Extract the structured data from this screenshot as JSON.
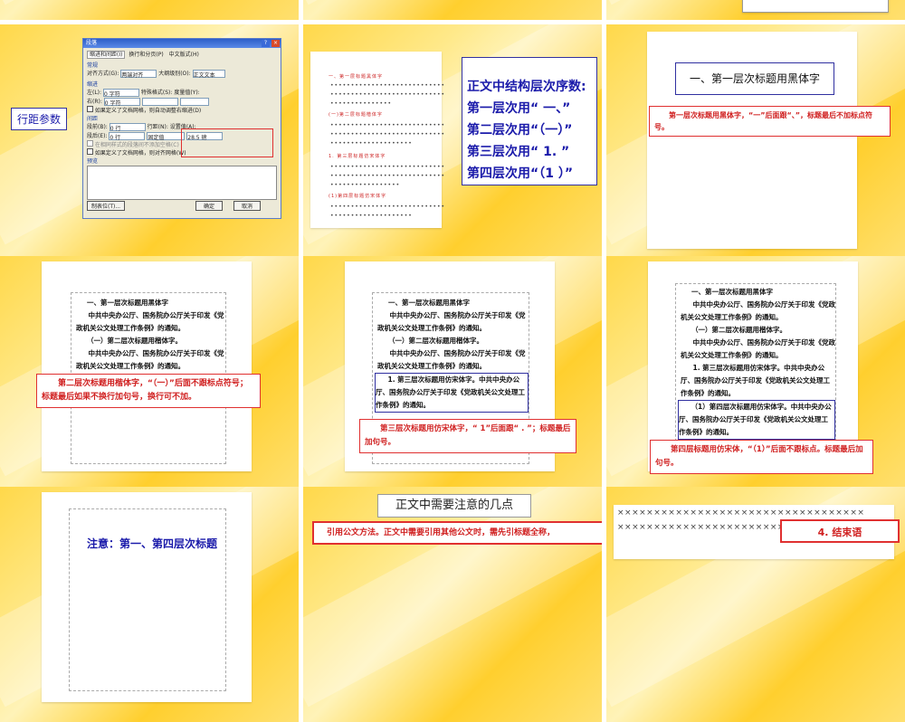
{
  "colors": {
    "accent_red": "#d02020",
    "accent_blue": "#1a1aaa"
  },
  "slide2": {
    "label": "行距参数",
    "dialog": {
      "title": "段落",
      "tabs": [
        "缩进和间距(I)",
        "换行和分页(P)",
        "中文版式(H)"
      ],
      "section_general": "常规",
      "align_label": "对齐方式(G):",
      "align_value": "两端对齐",
      "outline_label": "大纲级别(O):",
      "outline_value": "正文文本",
      "section_indent": "缩进",
      "left_label": "左(L):",
      "left_value": "0 字符",
      "right_label": "右(R):",
      "right_value": "0 字符",
      "special_label": "特殊格式(S):",
      "by_label": "度量值(Y):",
      "auto_indent": "如果定义了文档网格，则自动调整右缩进(D)",
      "section_spacing": "间距",
      "before_label": "段前(B):",
      "before_value": "0 行",
      "after_label": "段后(E):",
      "after_value": "0 行",
      "line_label": "行距(N):",
      "line_value": "固定值",
      "at_label": "设置值(A):",
      "at_value": "28.5 磅",
      "no_space": "在相同样式的段落间不添加空格(C)",
      "snap_grid": "如果定义了文档网格，则对齐网格(W)",
      "section_preview": "预览",
      "tabs_button": "制表位(T)...",
      "ok_button": "确定",
      "cancel_button": "取消"
    }
  },
  "slide3": {
    "lines": [
      "一、第一层标题黑体字",
      "(一)第二层标题楷体字",
      "1. 第三层标题仿宋体字",
      "(1)第四层标题仿宋体字"
    ],
    "box_title": "正文中结构层次序数:",
    "box_items": [
      "第一层次用“ 一、”",
      "第二层次用“（一）”",
      "第三层次用“ 1. ”",
      "第四层次用“（1 ）”"
    ]
  },
  "slide4": {
    "heading": "一、第一层次标题用黑体字",
    "note": "第一层次标题用黑体字，“一”后面跟“、”，标题最后不加标点符号。"
  },
  "body": {
    "h1": "一、第一层次标题用黑体字",
    "p1": "中共中央办公厅、国务院办公厅关于印发《党政机关公文处理工作条例》的通知。",
    "h2": "（一）第二层次标题用楷体字。",
    "p2": "中共中央办公厅、国务院办公厅关于印发《党政机关公文处理工作条例》的通知。",
    "h3": "1. 第三层次标题用仿宋体字。中共中央办公厅、国务院办公厅关于印发《党政机关公文处理工作条例》的通知。",
    "h4": "（1）第四层次标题用仿宋体字。中共中央办公厅、国务院办公厅关于印发《党政机关公文处理工作条例》的通知。"
  },
  "slide5": {
    "note": "第二层次标题用楷体字，“（一）”后面不跟标点符号；标题最后如果不换行加句号，换行可不加。"
  },
  "slide6": {
    "note": "第三层次标题用仿宋体字，“ 1”后面跟“ . ”；标题最后加句号。"
  },
  "slide7": {
    "note": "第四层标题用仿宋体，“（1）”后面不跟标点。标题最后加句号。"
  },
  "slide8": {
    "text": "注意：第一、第四层次标题"
  },
  "slide9": {
    "title": "正文中需要注意的几点",
    "note": "引用公文方法。正文中需要引用其他公文时，需先引标题全称，"
  },
  "slide10": {
    "xrow": "××××××××××××××××××××××××××××××××××",
    "label": "4. 结束语"
  }
}
